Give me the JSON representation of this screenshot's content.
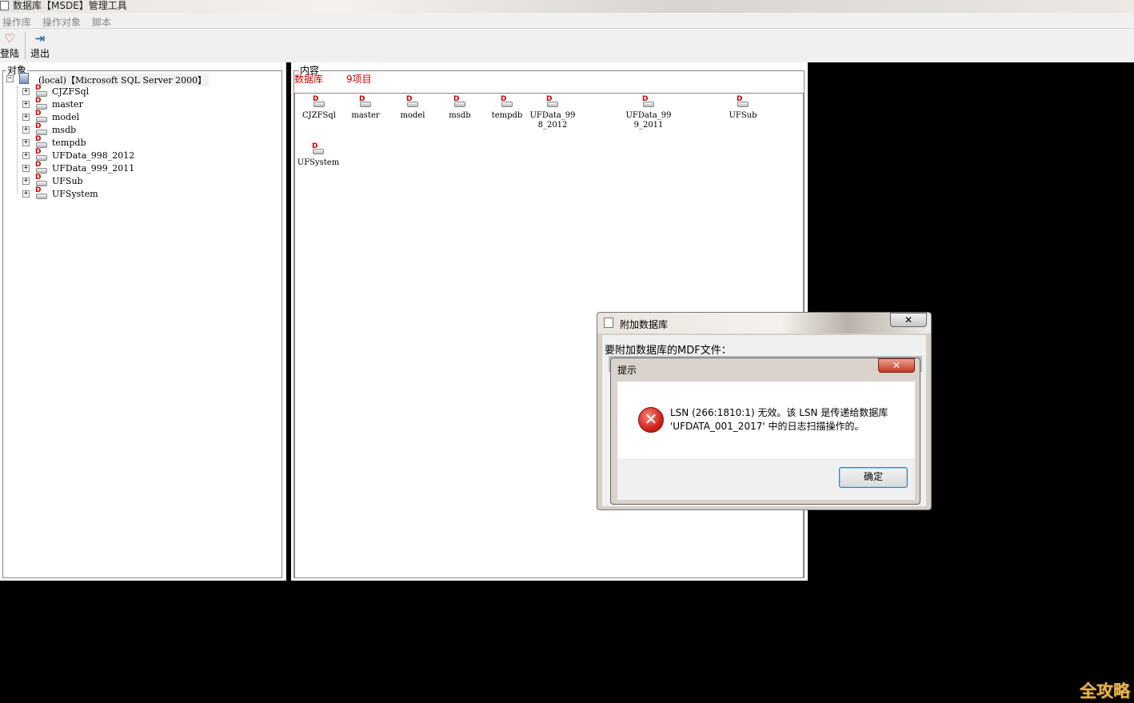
{
  "window": {
    "title": "数据库【MSDE】管理工具"
  },
  "menu": [
    "操作库",
    "操作对象",
    "脚本"
  ],
  "toolbar": {
    "login_label": "登陆",
    "exit_label": "退出"
  },
  "tree_panel": {
    "legend": "对象",
    "server": "(local)【Microsoft SQL Server  2000】",
    "databases": [
      "CJZFSql",
      "master",
      "model",
      "msdb",
      "tempdb",
      "UFData_998_2012",
      "UFData_999_2011",
      "UFSub",
      "UFSystem"
    ]
  },
  "content_panel": {
    "legend": "内容",
    "summary_type": "数据库",
    "summary_count": "9项目",
    "items": [
      "CJZFSql",
      "master",
      "model",
      "msdb",
      "tempdb",
      "UFData_99 8_2012",
      "UFData_99 9_2011",
      "UFSub",
      "UFSystem"
    ]
  },
  "attach_dialog": {
    "title": "附加数据库",
    "prompt": "要附加数据库的MDF文件：",
    "close_label": "✕"
  },
  "message_box": {
    "title": "提示",
    "line1": "LSN (266:1810:1) 无效。该 LSN 是传递给数据库",
    "line2": "'UFDATA_001_2017' 中的日志扫描操作的。",
    "ok_label": "确定",
    "close_label": "✕"
  },
  "watermark": "全攻略",
  "colors": {
    "error_red": "#d0231a",
    "summary_red": "#cc0000",
    "dialog_close_red": "#c43b22"
  }
}
